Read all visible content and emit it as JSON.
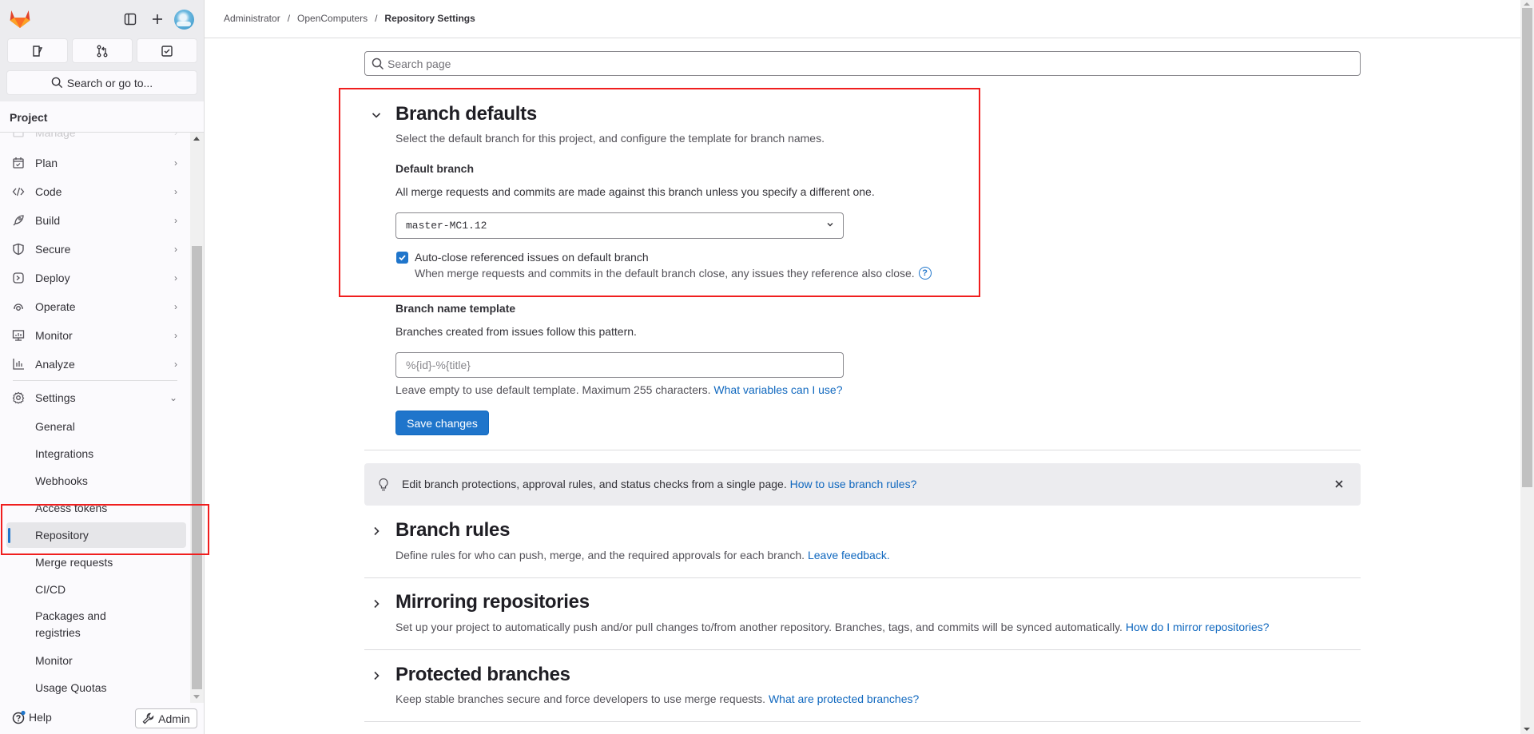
{
  "sidebar": {
    "search_label": "Search or go to...",
    "project_heading": "Project",
    "nav": [
      {
        "label": "Manage",
        "icon": "manage-icon"
      },
      {
        "label": "Plan",
        "icon": "plan-icon"
      },
      {
        "label": "Code",
        "icon": "code-icon"
      },
      {
        "label": "Build",
        "icon": "rocket-icon"
      },
      {
        "label": "Secure",
        "icon": "shield-icon"
      },
      {
        "label": "Deploy",
        "icon": "deploy-icon"
      },
      {
        "label": "Operate",
        "icon": "operate-icon"
      },
      {
        "label": "Monitor",
        "icon": "monitor-icon"
      },
      {
        "label": "Analyze",
        "icon": "chart-icon"
      },
      {
        "label": "Settings",
        "icon": "gear-icon"
      }
    ],
    "settings_items": [
      {
        "label": "General"
      },
      {
        "label": "Integrations"
      },
      {
        "label": "Webhooks"
      },
      {
        "label": "Access tokens"
      },
      {
        "label": "Repository",
        "active": true
      },
      {
        "label": "Merge requests"
      },
      {
        "label": "CI/CD"
      },
      {
        "label": "Packages and registries"
      },
      {
        "label": "Monitor"
      },
      {
        "label": "Usage Quotas"
      }
    ],
    "help_label": "Help",
    "admin_label": "Admin"
  },
  "breadcrumb": {
    "items": [
      "Administrator",
      "OpenComputers"
    ],
    "current": "Repository Settings",
    "separator": "/"
  },
  "search": {
    "placeholder": "Search page"
  },
  "branch_defaults": {
    "title": "Branch defaults",
    "description": "Select the default branch for this project, and configure the template for branch names.",
    "default_branch_label": "Default branch",
    "default_branch_help": "All merge requests and commits are made against this branch unless you specify a different one.",
    "default_branch_value": "master-MC1.12",
    "auto_close_label": "Auto-close referenced issues on default branch",
    "auto_close_checked": true,
    "auto_close_help": "When merge requests and commits in the default branch close, any issues they reference also close.",
    "template_label": "Branch name template",
    "template_help": "Branches created from issues follow this pattern.",
    "template_placeholder": "%{id}-%{title}",
    "template_value": "",
    "template_note": "Leave empty to use default template. Maximum 255 characters.",
    "template_link": "What variables can I use?",
    "save_label": "Save changes"
  },
  "alert": {
    "text": "Edit branch protections, approval rules, and status checks from a single page.",
    "link": "How to use branch rules?"
  },
  "sections": [
    {
      "title": "Branch rules",
      "description": "Define rules for who can push, merge, and the required approvals for each branch.",
      "link": "Leave feedback."
    },
    {
      "title": "Mirroring repositories",
      "description": "Set up your project to automatically push and/or pull changes to/from another repository. Branches, tags, and commits will be synced automatically.",
      "link": "How do I mirror repositories?"
    },
    {
      "title": "Protected branches",
      "description": "Keep stable branches secure and force developers to use merge requests.",
      "link": "What are protected branches?"
    }
  ],
  "colors": {
    "accent": "#1f75cb",
    "highlight": "#f01e1e",
    "brand": "#e24329"
  }
}
